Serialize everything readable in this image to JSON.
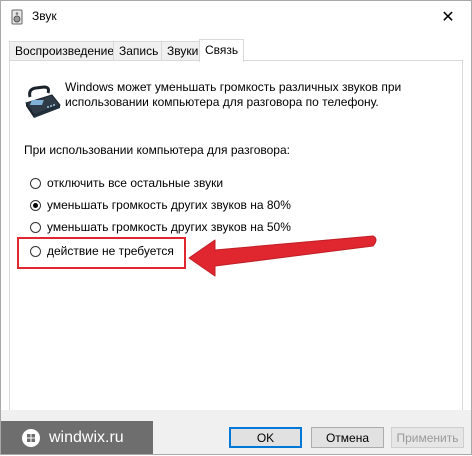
{
  "window": {
    "title": "Звук",
    "close_glyph": "✕"
  },
  "tabs": [
    {
      "label": "Воспроизведение",
      "active": false
    },
    {
      "label": "Запись",
      "active": false
    },
    {
      "label": "Звуки",
      "active": false
    },
    {
      "label": "Связь",
      "active": true
    }
  ],
  "panel": {
    "intro_text": "Windows может уменьшать громкость различных звуков при использовании компьютера для разговора по телефону.",
    "group_label": "При использовании компьютера для разговора:",
    "options": [
      {
        "label": "отключить все остальные звуки",
        "checked": false
      },
      {
        "label": "уменьшать громкость других звуков на 80%",
        "checked": true
      },
      {
        "label": "уменьшать громкость других звуков на 50%",
        "checked": false
      },
      {
        "label": "действие не требуется",
        "checked": false
      }
    ]
  },
  "buttons": {
    "ok": "OK",
    "cancel": "Отмена",
    "apply": "Применить"
  },
  "watermark": {
    "text": "windwix.ru"
  },
  "colors": {
    "annotation_red": "#e0262f",
    "accent_blue": "#0078d7"
  },
  "icons": {
    "window": "speaker-icon",
    "panel": "telephone-icon",
    "watermark": "windows-logo-icon"
  }
}
